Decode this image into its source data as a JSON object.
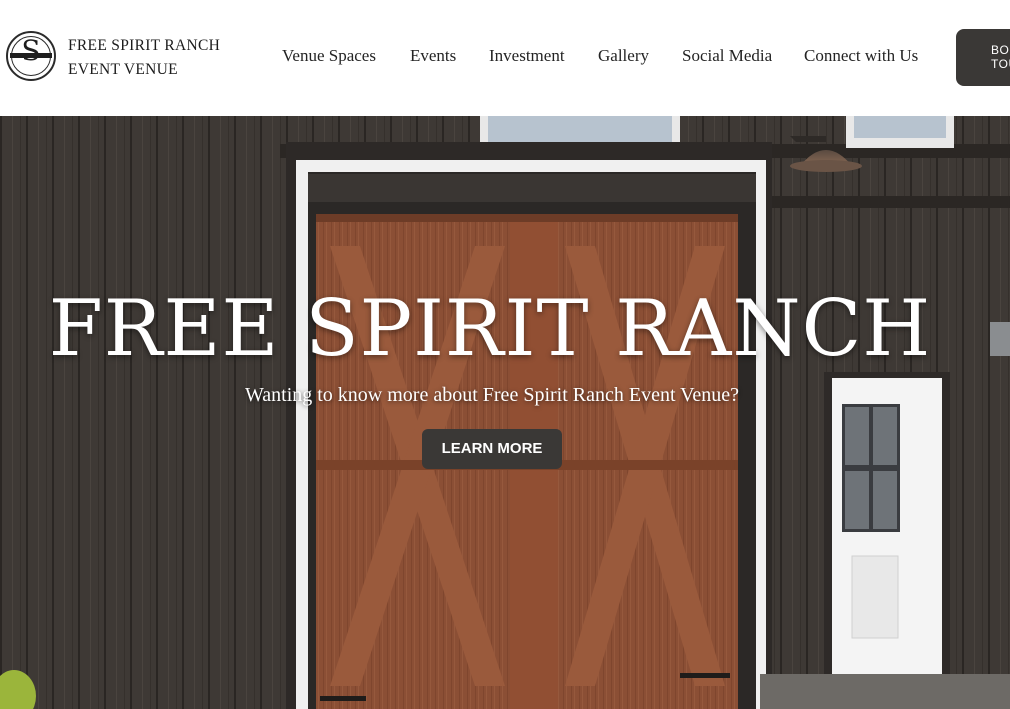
{
  "brand": {
    "logo_letter": "S",
    "name_line1": "FREE SPIRIT RANCH",
    "name_line2": "EVENT VENUE"
  },
  "nav": {
    "items": [
      {
        "label": "Venue Spaces"
      },
      {
        "label": "Events"
      },
      {
        "label": "Investment"
      },
      {
        "label": "Gallery"
      },
      {
        "label": "Social Media"
      },
      {
        "label": "Connect with Us"
      }
    ],
    "book_tour_line1": "BO",
    "book_tour_line2": "TOU"
  },
  "hero": {
    "title": "FREE SPIRIT RANCH",
    "subtitle": "Wanting to know more about Free Spirit Ranch Event Venue?",
    "cta_label": "LEARN MORE"
  },
  "colors": {
    "button_bg": "#3a3836",
    "barn_wood": "#3b3633",
    "garage_door": "#8a4e34",
    "trim": "#f2f2f2"
  }
}
